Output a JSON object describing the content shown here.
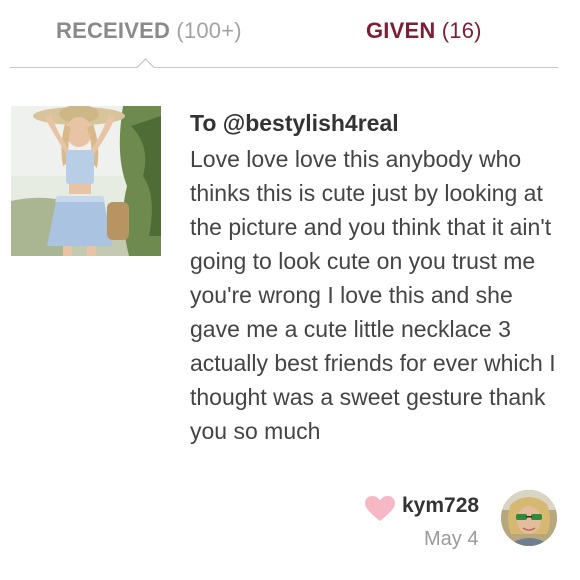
{
  "tabs": {
    "received": {
      "label": "RECEIVED",
      "count": "(100+)"
    },
    "given": {
      "label": "GIVEN",
      "count": "(16)"
    }
  },
  "review": {
    "recipient": "To @bestylish4real",
    "text": "Love love love this anybody who thinks this is cute just by looking at the picture and you think that it ain't going to look cute on you trust me you're wrong I love this and she gave me a cute little necklace 3 actually best friends for ever which I thought was a sweet gesture thank you so much",
    "reviewer": "kym728",
    "date": "May 4"
  },
  "colors": {
    "accent": "#7d1f37",
    "heart": "#f7b8c6",
    "text": "#444444",
    "muted": "#9a9a9a"
  },
  "icons": {
    "like": "heart-icon"
  }
}
